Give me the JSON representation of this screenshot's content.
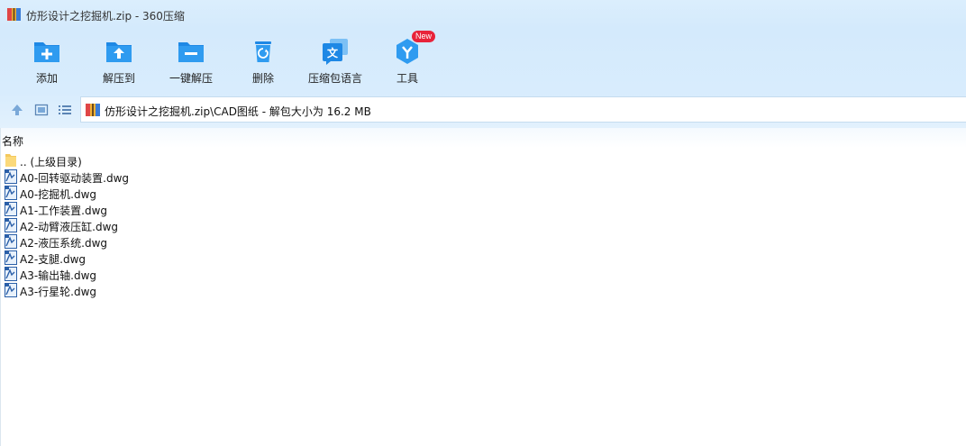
{
  "window": {
    "title": "仿形设计之挖掘机.zip - 360压缩",
    "app_icon": "archive-icon"
  },
  "toolbar": {
    "buttons": [
      {
        "label": "添加",
        "icon": "add-folder-icon"
      },
      {
        "label": "解压到",
        "icon": "extract-to-icon"
      },
      {
        "label": "一键解压",
        "icon": "one-click-extract-icon"
      },
      {
        "label": "删除",
        "icon": "trash-icon"
      },
      {
        "label": "压缩包语言",
        "icon": "language-icon"
      },
      {
        "label": "工具",
        "icon": "tools-icon",
        "badge": "New"
      }
    ]
  },
  "navigation": {
    "up_icon": "arrow-up-icon",
    "thumbnail_view_icon": "thumbnail-view-icon",
    "list_view_icon": "list-view-icon",
    "address": "仿形设计之挖掘机.zip\\CAD图纸 - 解包大小为 16.2 MB"
  },
  "file_list": {
    "column_header": "名称",
    "items": [
      {
        "name": ".. (上级目录)",
        "type": "parent-folder"
      },
      {
        "name": "A0-回转驱动装置.dwg",
        "type": "dwg"
      },
      {
        "name": "A0-挖掘机.dwg",
        "type": "dwg"
      },
      {
        "name": "A1-工作装置.dwg",
        "type": "dwg"
      },
      {
        "name": "A2-动臂液压缸.dwg",
        "type": "dwg"
      },
      {
        "name": "A2-液压系统.dwg",
        "type": "dwg"
      },
      {
        "name": "A2-支腿.dwg",
        "type": "dwg"
      },
      {
        "name": "A3-输出轴.dwg",
        "type": "dwg"
      },
      {
        "name": "A3-行星轮.dwg",
        "type": "dwg"
      }
    ]
  },
  "colors": {
    "accent": "#2b8fe0",
    "badge": "#e8233a",
    "toolbar_bg": "#d4eafc"
  }
}
